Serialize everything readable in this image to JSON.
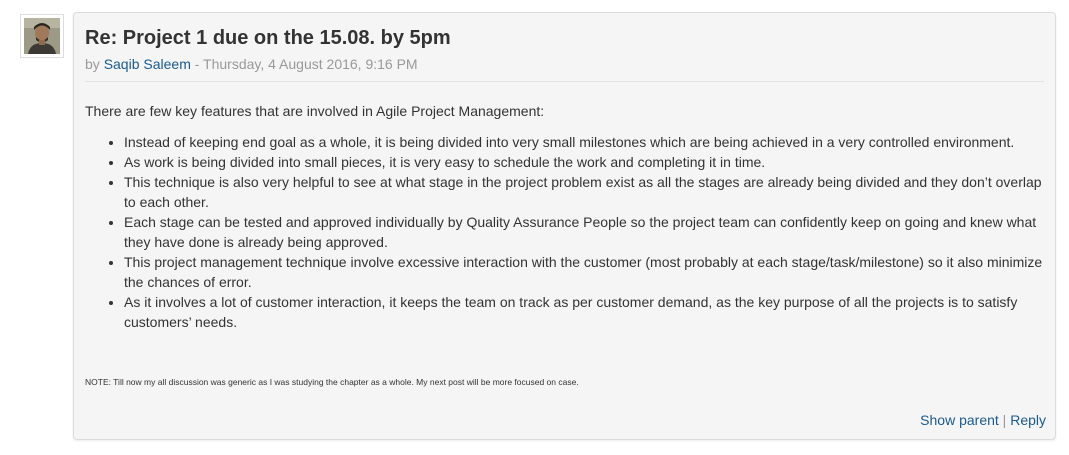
{
  "post": {
    "subject": "Re: Project 1 due on the 15.08. by 5pm",
    "by_prefix": "by",
    "author": "Saqib Saleem",
    "date": "- Thursday, 4 August 2016, 9:16 PM",
    "intro": "There are few key features that are involved in Agile Project Management:",
    "bullets": [
      "Instead of keeping end goal as a whole, it is being divided into very small milestones which are being achieved in a very controlled environment.",
      "As work is being divided into small pieces, it is very easy to schedule the work and completing it in time.",
      "This technique is also very helpful to see at what stage in the project problem exist as all the stages are already being divided and they don’t overlap to each other.",
      "Each stage can be tested and approved individually by Quality Assurance People so the project team can confidently keep on going and knew what they have done is already being approved.",
      "This project management technique involve excessive interaction with the customer (most probably at each stage/task/milestone) so it also minimize the chances of error.",
      "As it involves a lot of customer interaction, it keeps the team on track as per customer demand, as the key purpose of all the projects is to satisfy customers’ needs."
    ],
    "note": "NOTE: Till now my all discussion was generic as I was studying the chapter as a whole. My next post will be more focused on case.",
    "commands": {
      "show_parent": "Show parent",
      "separator": "|",
      "reply": "Reply"
    }
  },
  "colors": {
    "link": "#1a5a8e",
    "muted": "#999999",
    "post_background": "#f5f5f5"
  }
}
